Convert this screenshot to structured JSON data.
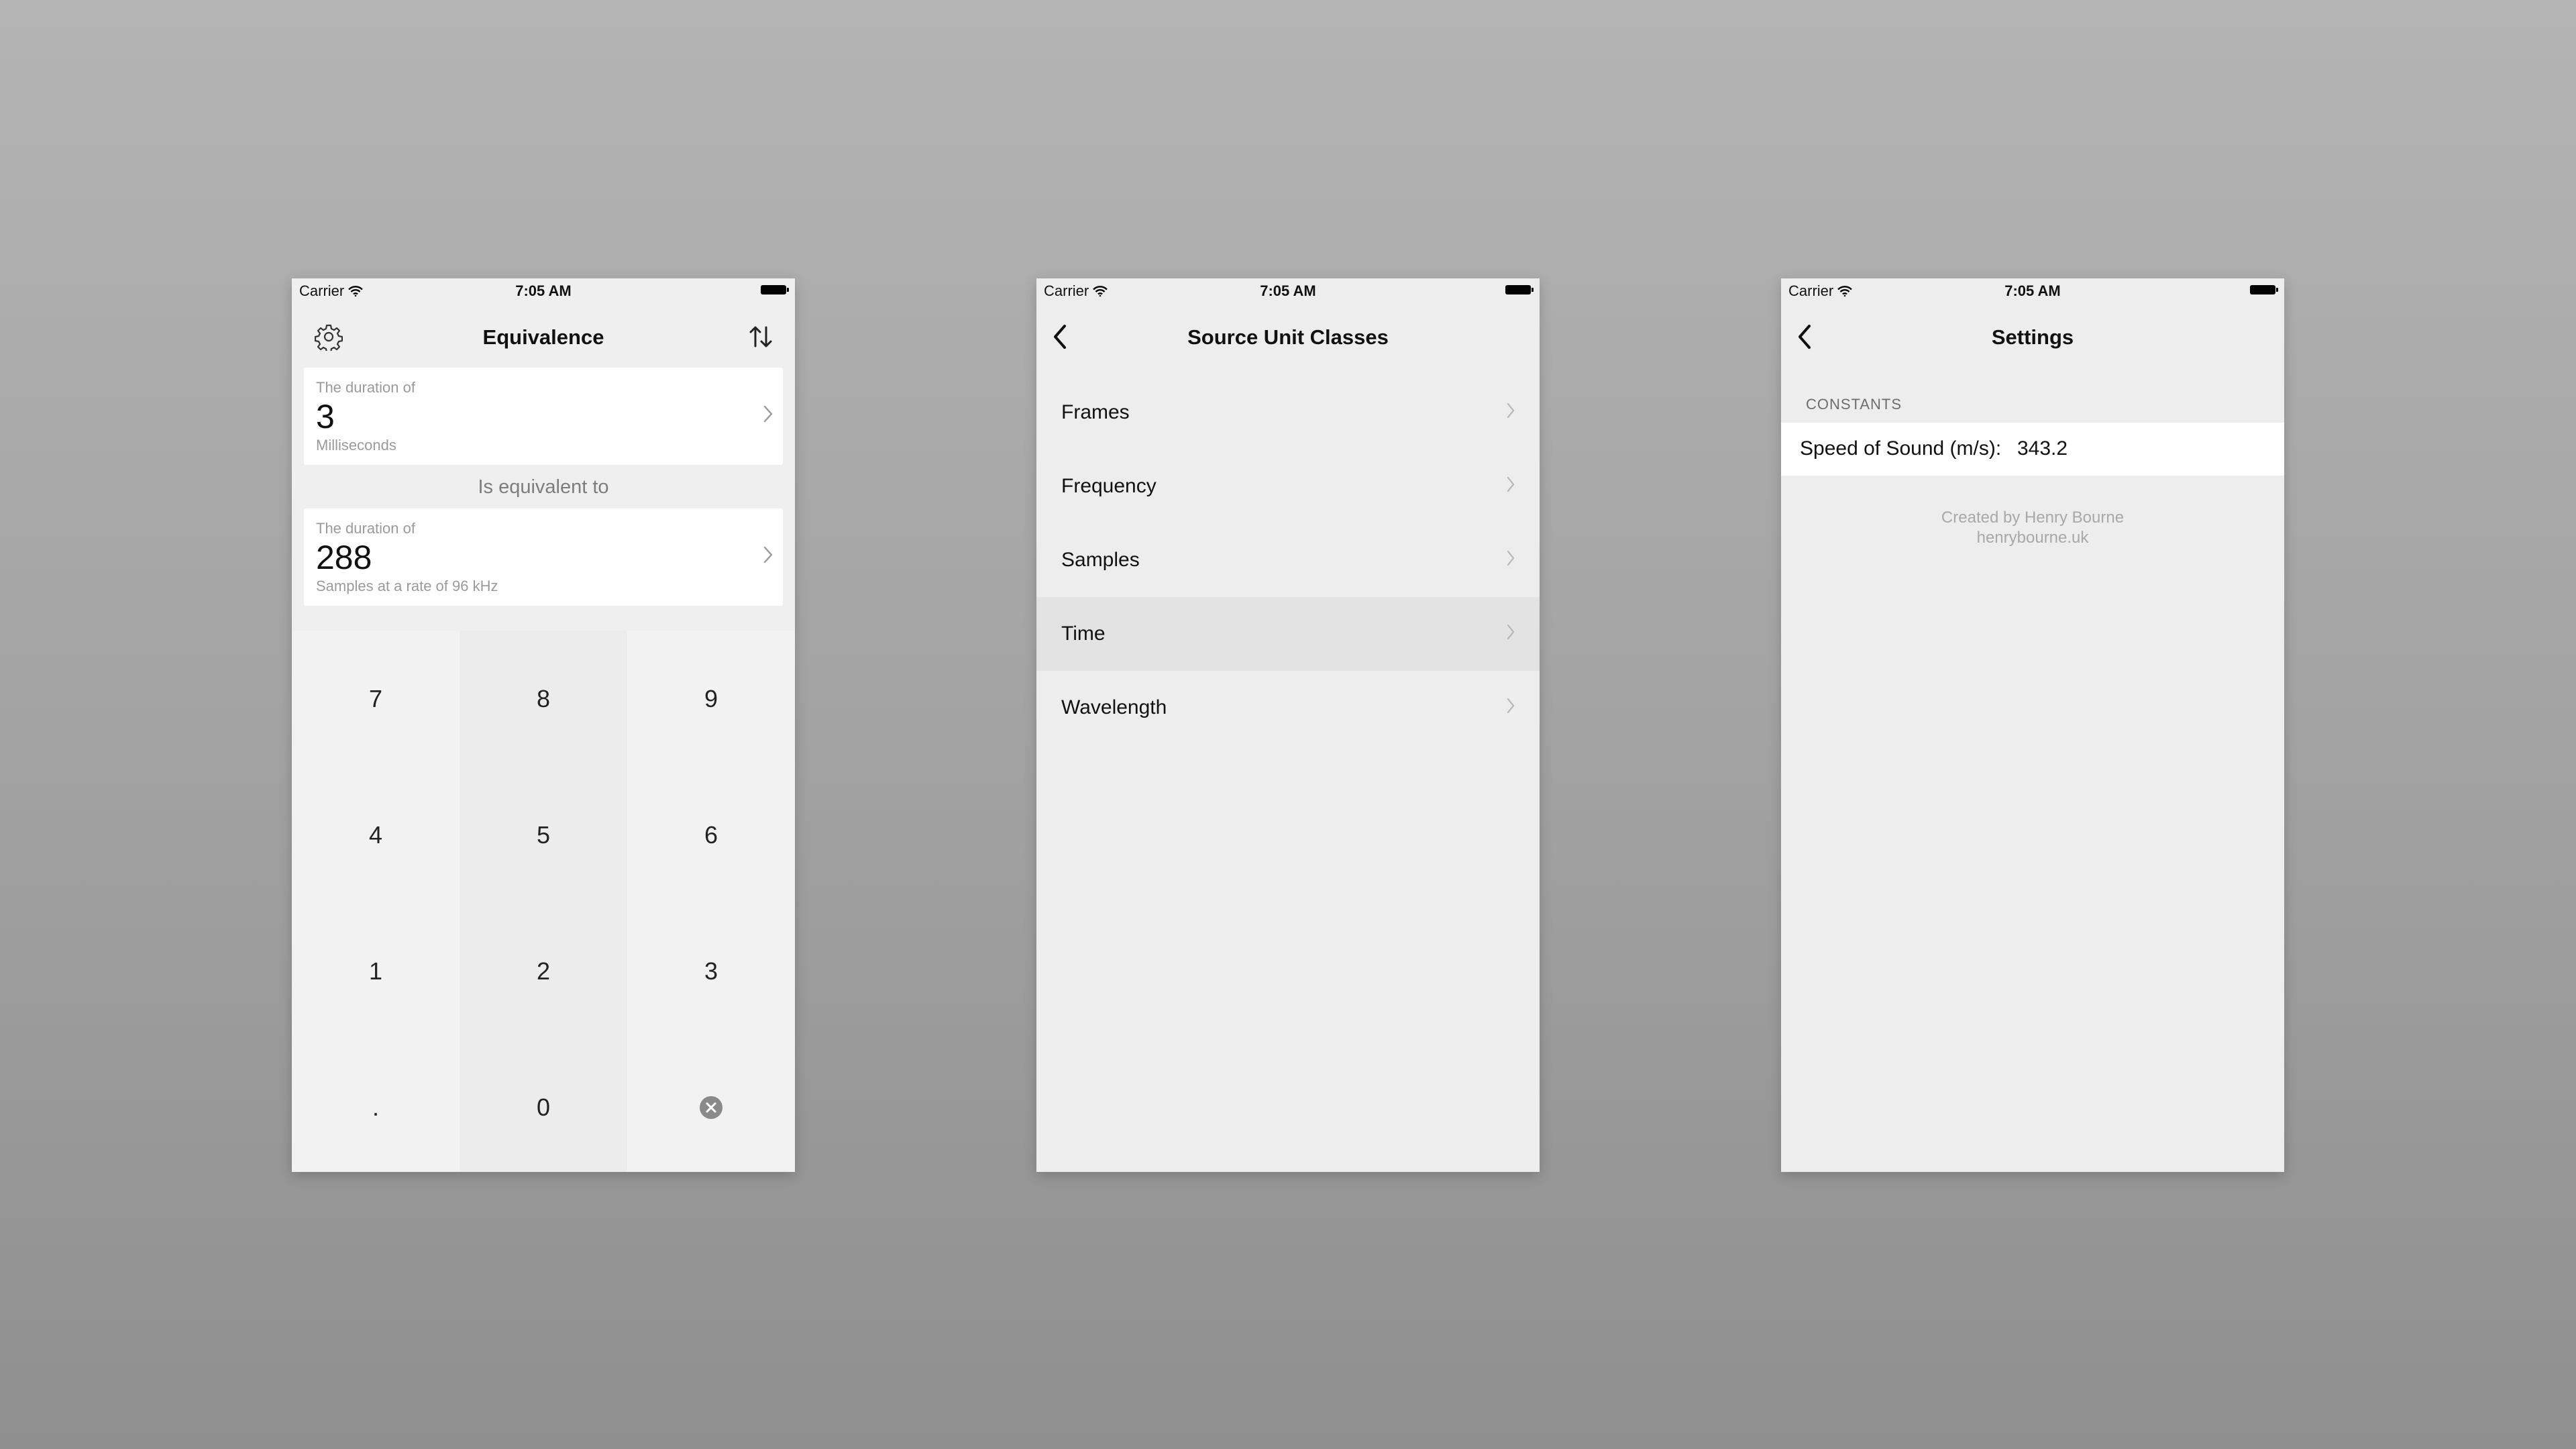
{
  "status_bar": {
    "carrier": "Carrier",
    "time": "7:05 AM"
  },
  "colors": {
    "background": "#a3a3a3",
    "screen": "#efefef",
    "card": "#ffffff",
    "secondary_text": "#9a9a9a",
    "selected_row": "#e3e3e3"
  },
  "equivalence_screen": {
    "title": "Equivalence",
    "icons": {
      "left": "gear-icon",
      "right": "swap-arrows-icon"
    },
    "source": {
      "label": "The duration of",
      "value": "3",
      "unit": "Milliseconds"
    },
    "equivalent_label": "Is equivalent to",
    "target": {
      "label": "The duration of",
      "value": "288",
      "unit": "Samples at a rate of 96 kHz"
    },
    "keys": [
      "7",
      "8",
      "9",
      "4",
      "5",
      "6",
      "1",
      "2",
      "3",
      ".",
      "0"
    ],
    "delete_icon": "delete-icon"
  },
  "source_units_screen": {
    "title": "Source Unit Classes",
    "items": [
      {
        "label": "Frames",
        "selected": false
      },
      {
        "label": "Frequency",
        "selected": false
      },
      {
        "label": "Samples",
        "selected": false
      },
      {
        "label": "Time",
        "selected": true
      },
      {
        "label": "Wavelength",
        "selected": false
      }
    ]
  },
  "settings_screen": {
    "title": "Settings",
    "section_header": "CONSTANTS",
    "speed_of_sound_label": "Speed of Sound (m/s):",
    "speed_of_sound_value": "343.2",
    "credit_line1": "Created by Henry Bourne",
    "credit_line2": "henrybourne.uk"
  }
}
